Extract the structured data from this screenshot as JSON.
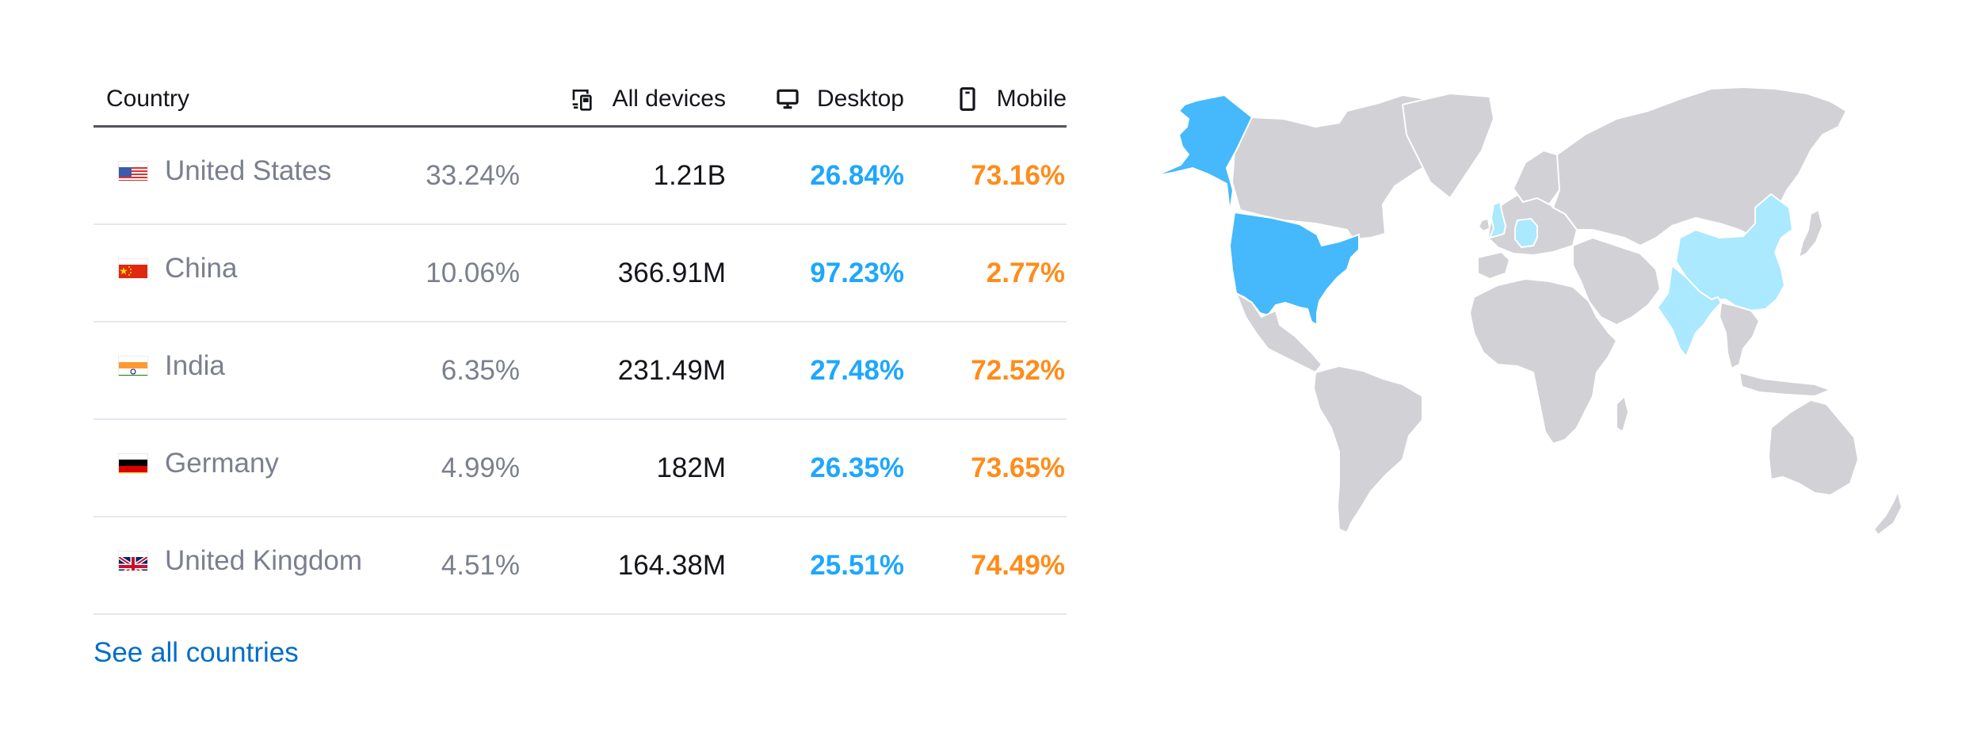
{
  "table": {
    "headers": {
      "country": "Country",
      "all_devices": "All devices",
      "desktop": "Desktop",
      "mobile": "Mobile"
    },
    "header_icons": {
      "all_devices": "devices-icon",
      "desktop": "desktop-icon",
      "mobile": "mobile-icon"
    },
    "rows": [
      {
        "country": "United States",
        "flag": "us-flag-icon",
        "share": "33.24%",
        "all_devices": "1.21B",
        "desktop": "26.84%",
        "mobile": "73.16%"
      },
      {
        "country": "China",
        "flag": "cn-flag-icon",
        "share": "10.06%",
        "all_devices": "366.91M",
        "desktop": "97.23%",
        "mobile": "2.77%"
      },
      {
        "country": "India",
        "flag": "in-flag-icon",
        "share": "6.35%",
        "all_devices": "231.49M",
        "desktop": "27.48%",
        "mobile": "72.52%"
      },
      {
        "country": "Germany",
        "flag": "de-flag-icon",
        "share": "4.99%",
        "all_devices": "182M",
        "desktop": "26.35%",
        "mobile": "73.65%"
      },
      {
        "country": "United Kingdom",
        "flag": "gb-flag-icon",
        "share": "4.51%",
        "all_devices": "164.38M",
        "desktop": "25.51%",
        "mobile": "74.49%"
      }
    ]
  },
  "see_all_label": "See all countries",
  "map": {
    "highlighted_countries": [
      {
        "country": "United States",
        "intensity": "high"
      },
      {
        "country": "China",
        "intensity": "low"
      },
      {
        "country": "India",
        "intensity": "low"
      },
      {
        "country": "Germany",
        "intensity": "low"
      },
      {
        "country": "United Kingdom",
        "intensity": "low"
      }
    ],
    "colors": {
      "land": "#d1d1d6",
      "high": "#45b9fb",
      "low": "#aae9ff"
    }
  },
  "colors": {
    "desktop": "#1ea7fd",
    "mobile": "#ff8c1a",
    "link": "#006dca",
    "muted_text": "#7b7f8e",
    "text": "#14151a"
  }
}
